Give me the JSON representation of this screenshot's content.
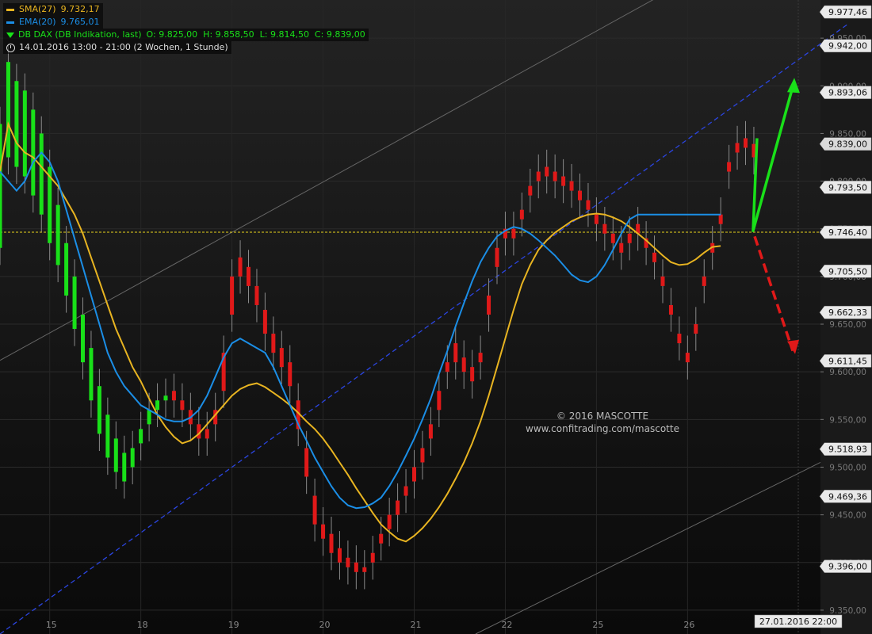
{
  "legend": {
    "sma": {
      "label": "SMA(27)",
      "value": "9.732,17",
      "color": "#e8b421"
    },
    "ema": {
      "label": "EMA(20)",
      "value": "9.765,01",
      "color": "#1b8ee6"
    },
    "instrument": {
      "label": "DB DAX (DB Indikation, last)",
      "ohlc": "O: 9.825,00  H: 9.858,50  L: 9.814,50  C: 9.839,00",
      "color": "#19e019"
    },
    "period": {
      "label": "14.01.2016 13:00 - 21:00 (2 Wochen, 1 Stunde)"
    }
  },
  "watermark": {
    "line1": "© 2016 MASCOTTE",
    "line2": "www.confitrading.com/mascotte"
  },
  "chart_data": {
    "type": "candlestick",
    "ylim": [
      9325,
      9990
    ],
    "y_ticks": [
      "9.350,00",
      "9.400,00",
      "9.450,00",
      "9.500,00",
      "9.550,00",
      "9.600,00",
      "9.650,00",
      "9.700,00",
      "9.750,00",
      "9.800,00",
      "9.850,00",
      "9.900,00",
      "9.950,00"
    ],
    "y_tick_values": [
      9350,
      9400,
      9450,
      9500,
      9550,
      9600,
      9650,
      9700,
      9750,
      9800,
      9850,
      9900,
      9950
    ],
    "price_labels": [
      {
        "value": 9977.46,
        "text": "9.977,46"
      },
      {
        "value": 9942.0,
        "text": "9.942,00"
      },
      {
        "value": 9893.06,
        "text": "9.893,06"
      },
      {
        "value": 9839.0,
        "text": "9.839,00",
        "highlight": true
      },
      {
        "value": 9793.5,
        "text": "9.793,50"
      },
      {
        "value": 9746.4,
        "text": "9.746,40"
      },
      {
        "value": 9705.5,
        "text": "9.705,50"
      },
      {
        "value": 9662.33,
        "text": "9.662,33"
      },
      {
        "value": 9611.45,
        "text": "9.611,45"
      },
      {
        "value": 9518.93,
        "text": "9.518,93"
      },
      {
        "value": 9469.36,
        "text": "9.469,36"
      },
      {
        "value": 9396.0,
        "text": "9.396,00"
      }
    ],
    "x_labels": [
      {
        "day": "15",
        "bar": 6
      },
      {
        "day": "18",
        "bar": 17
      },
      {
        "day": "19",
        "bar": 28
      },
      {
        "day": "20",
        "bar": 39
      },
      {
        "day": "21",
        "bar": 50
      },
      {
        "day": "22",
        "bar": 61
      },
      {
        "day": "25",
        "bar": 72
      },
      {
        "day": "26",
        "bar": 83
      }
    ],
    "cursor_date": "27.01.2016 22:00",
    "horizontal_line": {
      "value": 9746.4,
      "color": "#e6d21c"
    },
    "centers": [
      [
        9730,
        9860
      ],
      [
        9825,
        9925
      ],
      [
        9815,
        9905
      ],
      [
        9805,
        9895
      ],
      [
        9785,
        9875
      ],
      [
        9765,
        9850
      ],
      [
        9735,
        9815
      ],
      [
        9712,
        9775
      ],
      [
        9680,
        9735
      ],
      [
        9645,
        9700
      ],
      [
        9610,
        9660
      ],
      [
        9570,
        9625
      ],
      [
        9535,
        9585
      ],
      [
        9510,
        9555
      ],
      [
        9495,
        9530
      ],
      [
        9485,
        9515
      ],
      [
        9500,
        9520
      ],
      [
        9525,
        9540
      ],
      [
        9545,
        9560
      ],
      [
        9560,
        9570
      ],
      [
        9570,
        9575
      ],
      [
        9580,
        9570
      ],
      [
        9570,
        9560
      ],
      [
        9560,
        9545
      ],
      [
        9545,
        9530
      ],
      [
        9540,
        9530
      ],
      [
        9560,
        9545
      ],
      [
        9620,
        9580
      ],
      [
        9700,
        9660
      ],
      [
        9720,
        9700
      ],
      [
        9710,
        9690
      ],
      [
        9690,
        9670
      ],
      [
        9665,
        9640
      ],
      [
        9640,
        9620
      ],
      [
        9625,
        9605
      ],
      [
        9610,
        9585
      ],
      [
        9570,
        9540
      ],
      [
        9520,
        9490
      ],
      [
        9470,
        9440
      ],
      [
        9440,
        9425
      ],
      [
        9430,
        9410
      ],
      [
        9415,
        9400
      ],
      [
        9405,
        9395
      ],
      [
        9400,
        9390
      ],
      [
        9395,
        9390
      ],
      [
        9410,
        9400
      ],
      [
        9430,
        9420
      ],
      [
        9450,
        9435
      ],
      [
        9465,
        9450
      ],
      [
        9480,
        9470
      ],
      [
        9500,
        9485
      ],
      [
        9520,
        9505
      ],
      [
        9545,
        9530
      ],
      [
        9580,
        9560
      ],
      [
        9610,
        9600
      ],
      [
        9630,
        9610
      ],
      [
        9615,
        9600
      ],
      [
        9605,
        9590
      ],
      [
        9620,
        9610
      ],
      [
        9680,
        9660
      ],
      [
        9730,
        9710
      ],
      [
        9750,
        9740
      ],
      [
        9750,
        9740
      ],
      [
        9770,
        9760
      ],
      [
        9795,
        9785
      ],
      [
        9810,
        9800
      ],
      [
        9815,
        9805
      ],
      [
        9810,
        9800
      ],
      [
        9805,
        9795
      ],
      [
        9800,
        9790
      ],
      [
        9790,
        9780
      ],
      [
        9780,
        9770
      ],
      [
        9765,
        9755
      ],
      [
        9755,
        9745
      ],
      [
        9745,
        9735
      ],
      [
        9735,
        9725
      ],
      [
        9745,
        9735
      ],
      [
        9755,
        9745
      ],
      [
        9740,
        9730
      ],
      [
        9725,
        9715
      ],
      [
        9700,
        9690
      ],
      [
        9670,
        9660
      ],
      [
        9640,
        9630
      ],
      [
        9620,
        9610
      ],
      [
        9650,
        9640
      ],
      [
        9700,
        9690
      ],
      [
        9735,
        9725
      ],
      [
        9765,
        9755
      ],
      [
        9820,
        9810
      ],
      [
        9840,
        9830
      ],
      [
        9845,
        9835
      ],
      [
        9839,
        9825
      ]
    ],
    "sma": [
      9810,
      9860,
      9840,
      9830,
      9825,
      9815,
      9805,
      9795,
      9780,
      9765,
      9745,
      9720,
      9695,
      9670,
      9645,
      9625,
      9605,
      9590,
      9572,
      9555,
      9542,
      9532,
      9525,
      9528,
      9535,
      9545,
      9555,
      9565,
      9575,
      9582,
      9586,
      9588,
      9584,
      9578,
      9572,
      9565,
      9557,
      9548,
      9540,
      9530,
      9518,
      9505,
      9492,
      9478,
      9465,
      9452,
      9440,
      9432,
      9425,
      9422,
      9428,
      9436,
      9446,
      9458,
      9472,
      9488,
      9505,
      9525,
      9548,
      9575,
      9605,
      9635,
      9665,
      9692,
      9712,
      9728,
      9738,
      9746,
      9752,
      9758,
      9762,
      9765,
      9766,
      9765,
      9762,
      9758,
      9752,
      9745,
      9738,
      9730,
      9722,
      9715,
      9712,
      9713,
      9718,
      9725,
      9731,
      9732
    ],
    "ema": [
      9810,
      9800,
      9790,
      9800,
      9820,
      9830,
      9820,
      9800,
      9770,
      9740,
      9710,
      9680,
      9650,
      9620,
      9600,
      9585,
      9575,
      9565,
      9560,
      9555,
      9550,
      9548,
      9548,
      9552,
      9560,
      9575,
      9595,
      9615,
      9630,
      9635,
      9630,
      9625,
      9620,
      9605,
      9585,
      9565,
      9545,
      9528,
      9510,
      9495,
      9480,
      9468,
      9460,
      9457,
      9458,
      9462,
      9468,
      9480,
      9495,
      9512,
      9530,
      9550,
      9572,
      9598,
      9622,
      9648,
      9672,
      9695,
      9715,
      9730,
      9742,
      9748,
      9752,
      9750,
      9745,
      9738,
      9730,
      9722,
      9712,
      9702,
      9696,
      9694,
      9700,
      9712,
      9728,
      9745,
      9760,
      9765,
      9765,
      9765,
      9765,
      9765,
      9765,
      9765,
      9765,
      9765,
      9765,
      9765
    ]
  }
}
